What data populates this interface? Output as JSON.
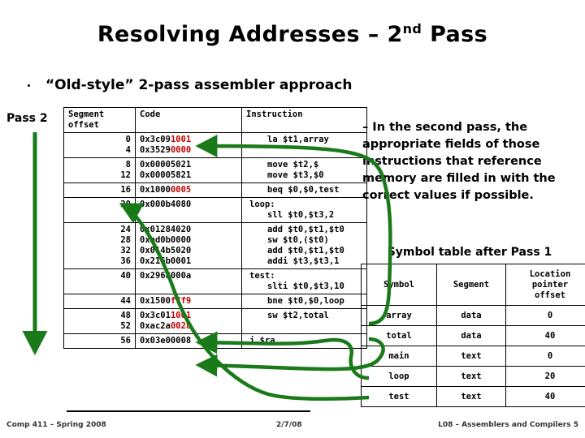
{
  "slide": {
    "title_main": "Resolving Addresses – 2",
    "title_sup": "nd",
    "title_tail": " Pass",
    "bullet": "“Old-style” 2-pass assembler approach",
    "pass_label": "Pass 2"
  },
  "accent": {
    "arrow_green": "#1a7a1a",
    "highlight_red": "#c00000"
  },
  "code_table": {
    "headers": {
      "offset": "Segment\noffset",
      "offset_line1": "Segment",
      "offset_line2": "offset",
      "code": "Code",
      "instruction": "Instruction"
    },
    "rows": [
      {
        "offsets": [
          "0",
          "4"
        ],
        "codes": [
          {
            "plain": "0x3c09",
            "red": "1001"
          },
          {
            "plain": "0x3529",
            "red": "0000"
          }
        ],
        "instructions": [
          "la $t1,array"
        ],
        "instr_align": "center"
      },
      {
        "offsets": [
          "8",
          "12"
        ],
        "codes": [
          {
            "plain": "0x00005021",
            "red": ""
          },
          {
            "plain": "0x00005821",
            "red": ""
          }
        ],
        "instructions": [
          "move $t2,$",
          "move $t3,$0"
        ],
        "instr_align": "center"
      },
      {
        "offsets": [
          "16"
        ],
        "codes": [
          {
            "plain": "0x1000",
            "red": "0005"
          }
        ],
        "instructions": [
          "beq $0,$0,test"
        ],
        "instr_align": "center"
      },
      {
        "offsets": [
          "20"
        ],
        "codes": [
          {
            "plain": "0x000b4080",
            "red": ""
          }
        ],
        "instructions": [
          "loop:",
          "sll $t0,$t3,2"
        ],
        "instr_align": "label"
      },
      {
        "offsets": [
          "24",
          "28",
          "32",
          "36"
        ],
        "codes": [
          {
            "plain": "0x01284020",
            "red": ""
          },
          {
            "plain": "0xad0b0000",
            "red": ""
          },
          {
            "plain": "0x014b5020",
            "red": ""
          },
          {
            "plain": "0x216b0001",
            "red": ""
          }
        ],
        "instructions": [
          "add  $t0,$t1,$t0",
          "sw   $t0,($t0)",
          "add  $t0,$t1,$t0",
          "addi $t3,$t3,1"
        ],
        "instr_align": "center"
      },
      {
        "offsets": [
          "40"
        ],
        "codes": [
          {
            "plain": "0x2968000a",
            "red": ""
          }
        ],
        "instructions": [
          "test:",
          "slti $t0,$t3,10"
        ],
        "instr_align": "label"
      },
      {
        "offsets": [
          "44"
        ],
        "codes": [
          {
            "plain": "0x1500",
            "red": "fff9"
          }
        ],
        "instructions": [
          "bne $t0,$0,loop"
        ],
        "instr_align": "center"
      },
      {
        "offsets": [
          "48",
          "52"
        ],
        "codes": [
          {
            "plain": "0x3c01",
            "red": "1001"
          },
          {
            "plain": "0xac2a",
            "red": "0028"
          }
        ],
        "instructions": [
          "sw  $t2,total"
        ],
        "instr_align": "center"
      },
      {
        "offsets": [
          "56"
        ],
        "codes": [
          {
            "plain": "0x03e00008",
            "red": ""
          }
        ],
        "instructions": [
          "j $ra"
        ],
        "instr_align": "label"
      }
    ]
  },
  "explanation": "– In the second pass, the appropriate fields of those instructions that reference memory are filled in with the correct values if possible.",
  "symbol_table": {
    "caption": "Symbol table after Pass 1",
    "headers": [
      "Symbol",
      "Segment",
      "Location\npointer\noffset"
    ],
    "header_symbol": "Symbol",
    "header_segment": "Segment",
    "header_loc_l1": "Location",
    "header_loc_l2": "pointer",
    "header_loc_l3": "offset",
    "rows": [
      {
        "symbol": "array",
        "segment": "data",
        "offset": "0"
      },
      {
        "symbol": "total",
        "segment": "data",
        "offset": "40"
      },
      {
        "symbol": "main",
        "segment": "text",
        "offset": "0"
      },
      {
        "symbol": "loop",
        "segment": "text",
        "offset": "20"
      },
      {
        "symbol": "test",
        "segment": "text",
        "offset": "40"
      }
    ]
  },
  "footer": {
    "left": "Comp 411 – Spring 2008",
    "center": "2/7/08",
    "right": "L08 – Assemblers and Compilers   5"
  }
}
